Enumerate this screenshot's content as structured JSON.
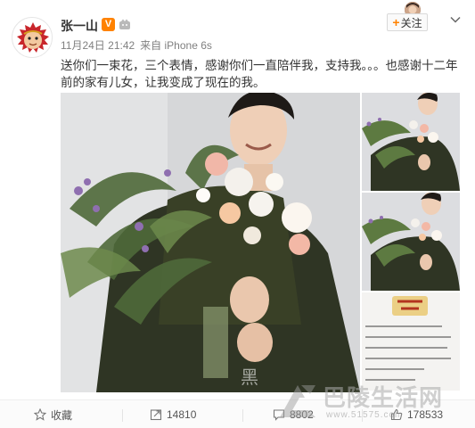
{
  "post": {
    "username": "张一山",
    "vip_badge": "V",
    "date": "11月24日 21:42",
    "source": "来自 iPhone 6s",
    "text": "送你们一束花，三个表情，感谢你们一直陪伴我，支持我。。。也感谢十二年前的家有儿女，让我变成了现在的我。"
  },
  "header": {
    "follow_label": "关注"
  },
  "actions": {
    "favorite_label": "收藏",
    "share_count": "14810",
    "comment_count": "8802",
    "like_count": "178533"
  },
  "watermark": {
    "text": "巴陵生活网",
    "url": "www.51575.com"
  },
  "colors": {
    "brand": "#ff8200",
    "text": "#333333",
    "meta": "#808080"
  },
  "icons": {
    "avatar": "monkey-avatar-icon",
    "verified": "v-badge-icon",
    "member": "member-crown-icon",
    "chevron": "chevron-down-icon",
    "favorite": "star-icon",
    "share": "share-icon",
    "comment": "comment-icon",
    "like": "thumbs-up-icon"
  }
}
